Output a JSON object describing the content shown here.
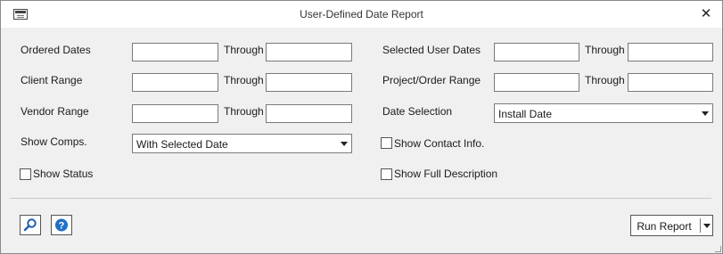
{
  "window": {
    "title": "User-Defined Date Report",
    "close_glyph": "✕"
  },
  "left": {
    "ordered_dates": {
      "label": "Ordered Dates",
      "through": "Through",
      "from_value": "",
      "to_value": ""
    },
    "client_range": {
      "label": "Client Range",
      "through": "Through",
      "from_value": "",
      "to_value": ""
    },
    "vendor_range": {
      "label": "Vendor Range",
      "through": "Through",
      "from_value": "",
      "to_value": ""
    },
    "show_comps": {
      "label": "Show Comps.",
      "selected": "With Selected Date"
    },
    "show_status": {
      "label": "Show Status",
      "checked": false
    }
  },
  "right": {
    "selected_user_dates": {
      "label": "Selected User Dates",
      "through": "Through",
      "from_value": "",
      "to_value": ""
    },
    "project_order_range": {
      "label": "Project/Order Range",
      "through": "Through",
      "from_value": "",
      "to_value": ""
    },
    "date_selection": {
      "label": "Date Selection",
      "selected": "Install Date"
    },
    "show_contact_info": {
      "label": "Show Contact Info.",
      "checked": false
    },
    "show_full_description": {
      "label": "Show Full Description",
      "checked": false
    }
  },
  "footer": {
    "search_icon": "magnifier-icon",
    "help_icon": "help-icon",
    "run_report_label": "Run Report"
  },
  "colors": {
    "help_blue": "#1f6fc5",
    "search_blue": "#1f5fb0"
  }
}
